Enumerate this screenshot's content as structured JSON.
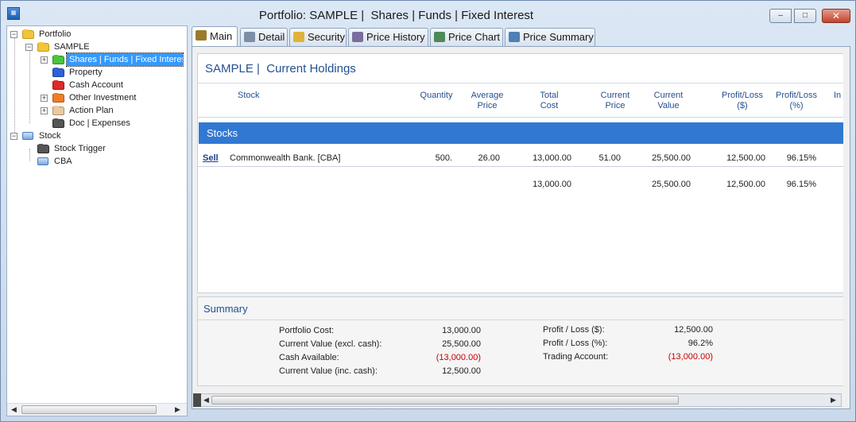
{
  "window": {
    "title": "Portfolio: SAMPLE |  Shares | Funds | Fixed Interest",
    "app_icon": "app-icon",
    "minimize": "–",
    "maximize": "□",
    "close": "✕"
  },
  "tree": {
    "portfolio": "Portfolio",
    "sample": "SAMPLE",
    "items": [
      {
        "label": "Shares | Funds | Fixed Interest",
        "icon": "green-folder-icon",
        "color": "#4cc43a"
      },
      {
        "label": "Property",
        "icon": "blue-folder-icon",
        "color": "#2f62d6"
      },
      {
        "label": "Cash Account",
        "icon": "red-folder-icon",
        "color": "#e02a2a"
      },
      {
        "label": "Other Investment",
        "icon": "orange-folder-icon",
        "color": "#f07d26"
      },
      {
        "label": "Action Plan",
        "icon": "beige-folder-icon",
        "color": "#e9c9a3"
      },
      {
        "label": "Doc | Expenses",
        "icon": "gray-folder-icon",
        "color": "#555555"
      }
    ],
    "stock": "Stock",
    "stock_trigger": "Stock Trigger",
    "cba": "CBA"
  },
  "tabs": [
    {
      "label": "Main",
      "icon": "main-tab-icon",
      "color": "#9b7b2c"
    },
    {
      "label": "Detail",
      "icon": "detail-tab-icon",
      "color": "#7d8fa8"
    },
    {
      "label": "Security",
      "icon": "security-tab-icon",
      "color": "#e0b23b"
    },
    {
      "label": "Price History",
      "icon": "price-history-tab-icon",
      "color": "#7a6e9e"
    },
    {
      "label": "Price Chart",
      "icon": "price-chart-tab-icon",
      "color": "#4c8a5a"
    },
    {
      "label": "Price Summary",
      "icon": "price-summary-tab-icon",
      "color": "#4f7fb4"
    }
  ],
  "holdings": {
    "title": "SAMPLE |  Current Holdings",
    "columns": {
      "stock": "Stock",
      "quantity": "Quantity",
      "average_price": "Average\nPrice",
      "total_cost": "Total\nCost",
      "current_price": "Current\nPrice",
      "current_value": "Current\nValue",
      "profit_loss_dollar": "Profit/Loss\n($)",
      "profit_loss_pct": "Profit/Loss\n(%)",
      "more": "In"
    },
    "group": "Stocks",
    "row": {
      "action": "Sell",
      "stock": "Commonwealth Bank. [CBA]",
      "quantity": "500.",
      "average_price": "26.00",
      "total_cost": "13,000.00",
      "current_price": "51.00",
      "current_value": "25,500.00",
      "profit_loss": "12,500.00",
      "profit_loss_pct": "96.15%"
    },
    "totals": {
      "total_cost": "13,000.00",
      "current_value": "25,500.00",
      "profit_loss": "12,500.00",
      "profit_loss_pct": "96.15%"
    }
  },
  "summary": {
    "title": "Summary",
    "portfolio_cost_label": "Portfolio Cost:",
    "portfolio_cost": "13,000.00",
    "current_value_excl_label": "Current Value (excl. cash):",
    "current_value_excl": "25,500.00",
    "cash_available_label": "Cash Available:",
    "cash_available": "(13,000.00)",
    "current_value_inc_label": "Current Value (inc. cash):",
    "current_value_inc": "12,500.00",
    "pl_dollar_label": "Profit / Loss ($):",
    "pl_dollar": "12,500.00",
    "pl_pct_label": "Profit / Loss (%):",
    "pl_pct": "96.2%",
    "trading_account_label": "Trading Account:",
    "trading_account": "(13,000.00)",
    "negative_color": "#cc0000"
  }
}
